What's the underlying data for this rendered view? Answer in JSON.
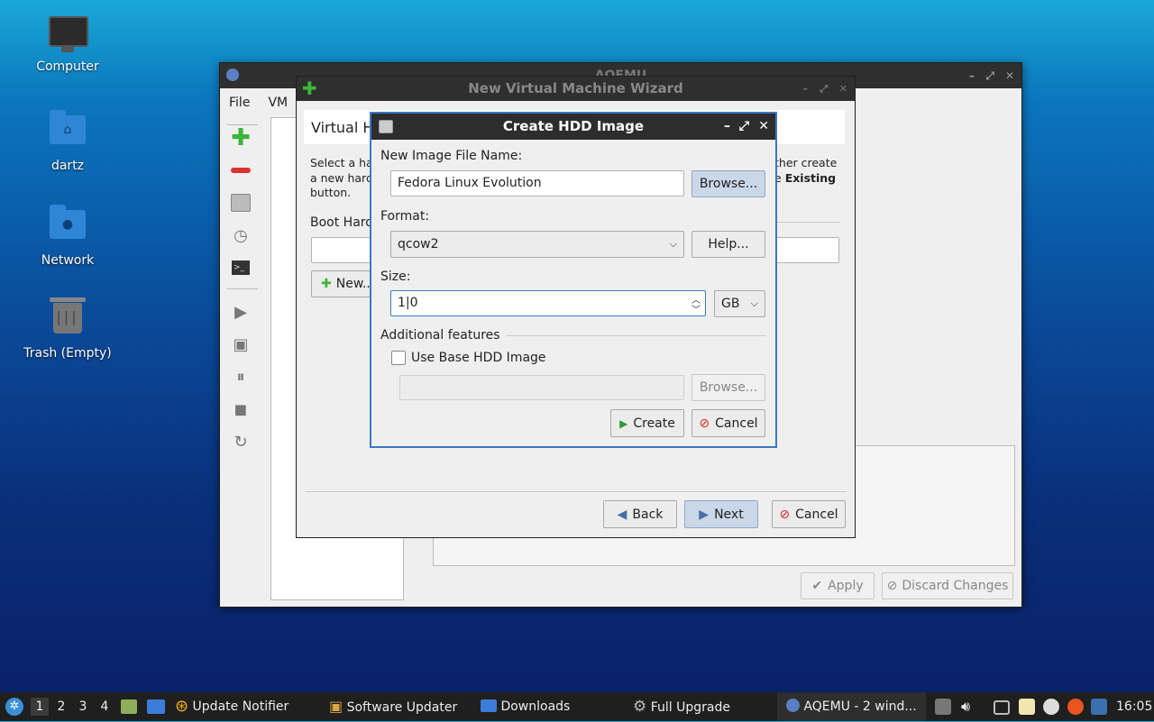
{
  "desktop": {
    "icons": [
      {
        "label": "Computer"
      },
      {
        "label": "dartz"
      },
      {
        "label": "Network"
      },
      {
        "label": "Trash (Empty)"
      }
    ]
  },
  "main_window": {
    "title": "AQEMU",
    "menu": [
      "File",
      "VM"
    ],
    "apply_label": "Apply",
    "discard_label": "Discard Changes"
  },
  "wizard": {
    "title": "New Virtual Machine Wizard",
    "heading": "Virtual Ha",
    "text_left_1": "Select a har",
    "text_left_2": "a new hard",
    "text_left_3": "button.",
    "text_right_1": "ther create",
    "text_right_2": "e",
    "text_right_bold": "Existing",
    "boot_label": "Boot Hard",
    "new_button": "New...",
    "back_label": "Back",
    "next_label": "Next",
    "cancel_label": "Cancel"
  },
  "hdd_dialog": {
    "title": "Create HDD Image",
    "file_name_label": "New Image File Name:",
    "file_name_value": "Fedora Linux Evolution",
    "browse_label": "Browse...",
    "format_label": "Format:",
    "format_value": "qcow2",
    "help_label": "Help...",
    "size_label": "Size:",
    "size_value": "1|0",
    "unit_value": "GB",
    "additional_label": "Additional features",
    "use_base_label": "Use Base HDD Image",
    "use_base_checked": false,
    "base_path_value": "",
    "base_browse_label": "Browse...",
    "create_label": "Create",
    "cancel_label": "Cancel"
  },
  "taskbar": {
    "workspaces": [
      "1",
      "2",
      "3",
      "4"
    ],
    "tasks": [
      {
        "label": "Update Notifier"
      },
      {
        "label": "Software Updater"
      },
      {
        "label": "Downloads"
      },
      {
        "label": "Full Upgrade"
      },
      {
        "label": "AQEMU - 2 wind..."
      }
    ],
    "clock": "16:05"
  },
  "colors": {
    "accent": "#3a78c4",
    "titlebar": "#2d2d2d",
    "taskbar": "#1f1f1f",
    "green_add": "#3cb43c",
    "red_remove": "#d33"
  }
}
